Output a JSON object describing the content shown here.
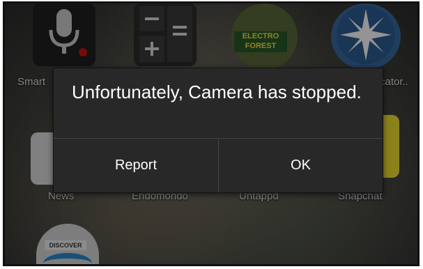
{
  "home_screen": {
    "top_row_labels": [
      "Smart",
      "cator.."
    ],
    "bottom_row_labels": [
      "News",
      "Endomondo",
      "Untappd",
      "Snapchat"
    ],
    "dock_icon_text": "DISCOVER",
    "forest_icon_text": "ELECTRO FOREST"
  },
  "dialog": {
    "message": "Unfortunately, Camera has stopped.",
    "report_label": "Report",
    "ok_label": "OK"
  },
  "colors": {
    "dialog_bg": "#282828",
    "separator": "#444444",
    "text": "#ffffff"
  }
}
